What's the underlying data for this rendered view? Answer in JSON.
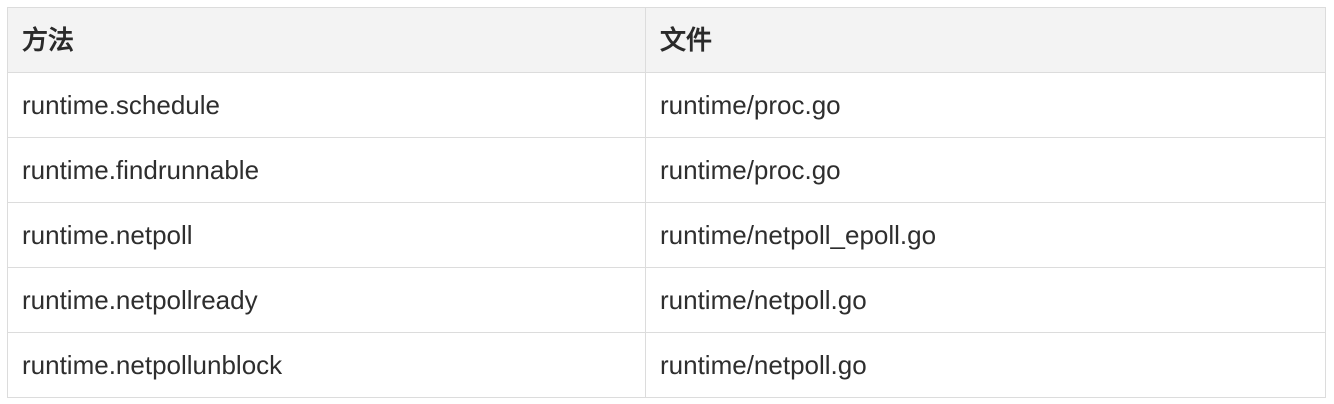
{
  "table": {
    "headers": [
      "方法",
      "文件"
    ],
    "rows": [
      [
        "runtime.schedule",
        "runtime/proc.go"
      ],
      [
        "runtime.findrunnable",
        "runtime/proc.go"
      ],
      [
        "runtime.netpoll",
        "runtime/netpoll_epoll.go"
      ],
      [
        "runtime.netpollready",
        "runtime/netpoll.go"
      ],
      [
        "runtime.netpollunblock",
        "runtime/netpoll.go"
      ]
    ]
  }
}
